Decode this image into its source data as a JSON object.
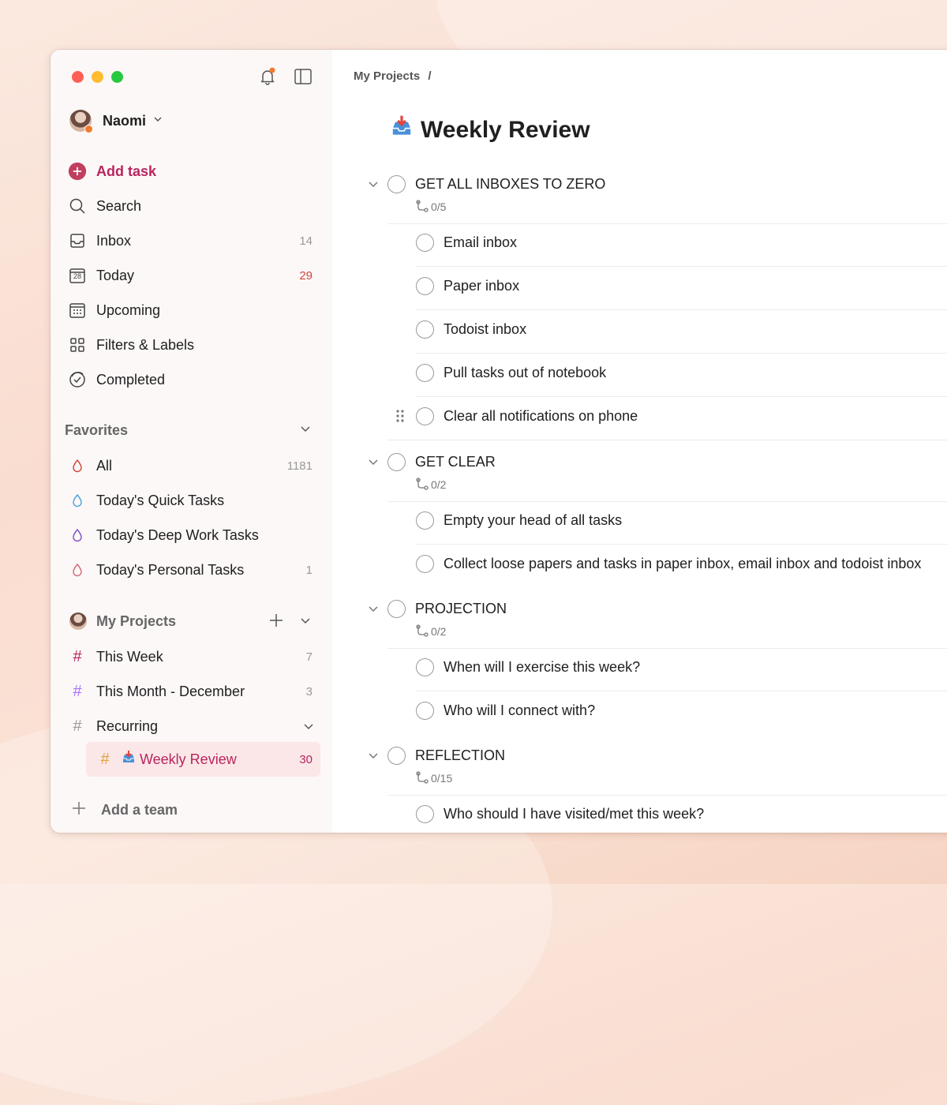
{
  "sidebar": {
    "user_name": "Naomi",
    "nav": {
      "add_task": "Add task",
      "search": "Search",
      "inbox": "Inbox",
      "inbox_count": "14",
      "today": "Today",
      "today_icon_num": "28",
      "today_count": "29",
      "upcoming": "Upcoming",
      "filters": "Filters & Labels",
      "completed": "Completed"
    },
    "favorites": {
      "heading": "Favorites",
      "items": [
        {
          "label": "All",
          "count": "1181",
          "color": "#d1453b"
        },
        {
          "label": "Today's Quick Tasks",
          "count": "",
          "color": "#4aa3df"
        },
        {
          "label": "Today's Deep Work Tasks",
          "count": "",
          "color": "#7e4fc7"
        },
        {
          "label": "Today's Personal Tasks",
          "count": "1",
          "color": "#d16a7a"
        }
      ]
    },
    "projects": {
      "heading": "My Projects",
      "items": [
        {
          "label": "This Week",
          "count": "7",
          "hash_color": "#b8255f"
        },
        {
          "label": "This Month - December",
          "count": "3",
          "hash_color": "#a970ff"
        },
        {
          "label": "Recurring",
          "count": "",
          "hash_color": "#9b9b9b"
        },
        {
          "label": "Weekly Review",
          "count": "30",
          "hash_color": "#e2a23b"
        }
      ]
    },
    "add_team": "Add a team"
  },
  "main": {
    "breadcrumb": "My Projects",
    "breadcrumb_sep": "/",
    "title": "Weekly Review",
    "sections": [
      {
        "title": "GET ALL INBOXES TO ZERO",
        "progress": "0/5",
        "tasks": [
          "Email inbox",
          "Paper inbox",
          "Todoist inbox",
          "Pull tasks out of notebook",
          "Clear all notifications on phone"
        ]
      },
      {
        "title": "GET CLEAR",
        "progress": "0/2",
        "tasks": [
          "Empty your head of all tasks",
          "Collect loose papers and tasks in paper inbox, email inbox and todoist inbox"
        ]
      },
      {
        "title": "PROJECTION",
        "progress": "0/2",
        "tasks": [
          "When will I exercise this week?",
          "Who will I connect with?"
        ]
      },
      {
        "title": "REFLECTION",
        "progress": "0/15",
        "tasks": [
          "Who should I have visited/met this week?"
        ]
      }
    ]
  }
}
